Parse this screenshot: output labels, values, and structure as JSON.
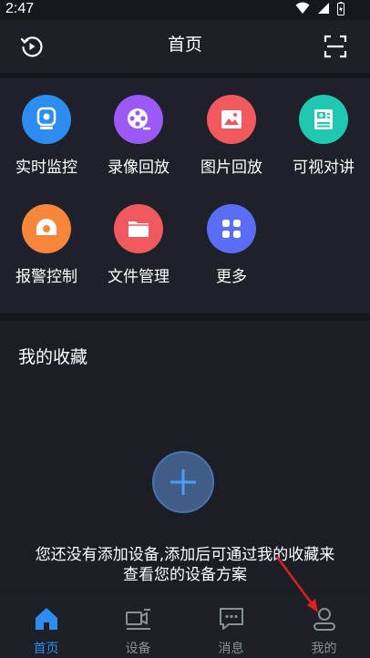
{
  "status_bar": {
    "time": "2:47"
  },
  "header": {
    "title": "首页",
    "left_icon": "playback-history-icon",
    "right_icon": "scan-icon"
  },
  "grid": [
    {
      "label": "实时监控",
      "icon": "camera-icon",
      "color": "#2d8cf0"
    },
    {
      "label": "录像回放",
      "icon": "film-reel-icon",
      "color": "#9b59f6"
    },
    {
      "label": "图片回放",
      "icon": "image-icon",
      "color": "#f0595d"
    },
    {
      "label": "可视对讲",
      "icon": "intercom-icon",
      "color": "#1fc8b0"
    },
    {
      "label": "报警控制",
      "icon": "alarm-icon",
      "color": "#f5863c"
    },
    {
      "label": "文件管理",
      "icon": "folder-icon",
      "color": "#f0595d"
    },
    {
      "label": "更多",
      "icon": "more-apps-icon",
      "color": "#5b6cf5"
    }
  ],
  "favorites": {
    "title": "我的收藏",
    "empty_text": "您还没有添加设备,添加后可通过我的收藏来查看您的设备方案"
  },
  "bottom_nav": [
    {
      "label": "首页",
      "icon": "home-icon",
      "active": true
    },
    {
      "label": "设备",
      "icon": "device-icon",
      "active": false
    },
    {
      "label": "消息",
      "icon": "message-icon",
      "active": false
    },
    {
      "label": "我的",
      "icon": "profile-icon",
      "active": false
    }
  ],
  "colors": {
    "active": "#2d8cf0",
    "inactive": "#8a8f98",
    "annotation": "#e02020"
  }
}
